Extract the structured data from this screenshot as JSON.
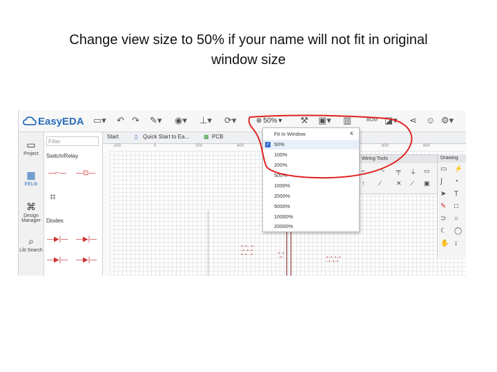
{
  "caption": {
    "line1": "Change view size to 50% if your name will not fit in original",
    "line2": "window size"
  },
  "app": {
    "logo_text": "EasyEDA",
    "zoom_label": "50%"
  },
  "leftbar": {
    "items": [
      {
        "label": "Project",
        "icon": "folder-icon"
      },
      {
        "label": "EELib",
        "icon": "library-icon"
      },
      {
        "label": "Design Manager",
        "icon": "design-manager-icon"
      },
      {
        "label": "Lib Search",
        "icon": "magnifier-icon"
      }
    ]
  },
  "library": {
    "filter_placeholder": "Filter",
    "switch_label": "Switch/Relay",
    "diodes_label": "Diodes"
  },
  "tabs": [
    {
      "label": "Start"
    },
    {
      "label": "Quick Start to Ea..."
    },
    {
      "label": "PCB"
    }
  ],
  "ruler": {
    "ticks": [
      "-200",
      "0",
      "200",
      "400",
      "600",
      "800"
    ]
  },
  "zoom_menu": {
    "fit_label": "Fit In Window",
    "fit_shortcut": "K",
    "options": [
      "50%",
      "100%",
      "200%",
      "500%",
      "1000%",
      "2000%",
      "5000%",
      "10000%",
      "20000%"
    ],
    "selected": "50%"
  },
  "panels": {
    "wiring_tools": "Wiring Tools",
    "drawing_tools": "Drawing"
  },
  "colors": {
    "accent": "#3a6fd0",
    "annotation": "#e02020",
    "logo": "#2a6ebb"
  }
}
